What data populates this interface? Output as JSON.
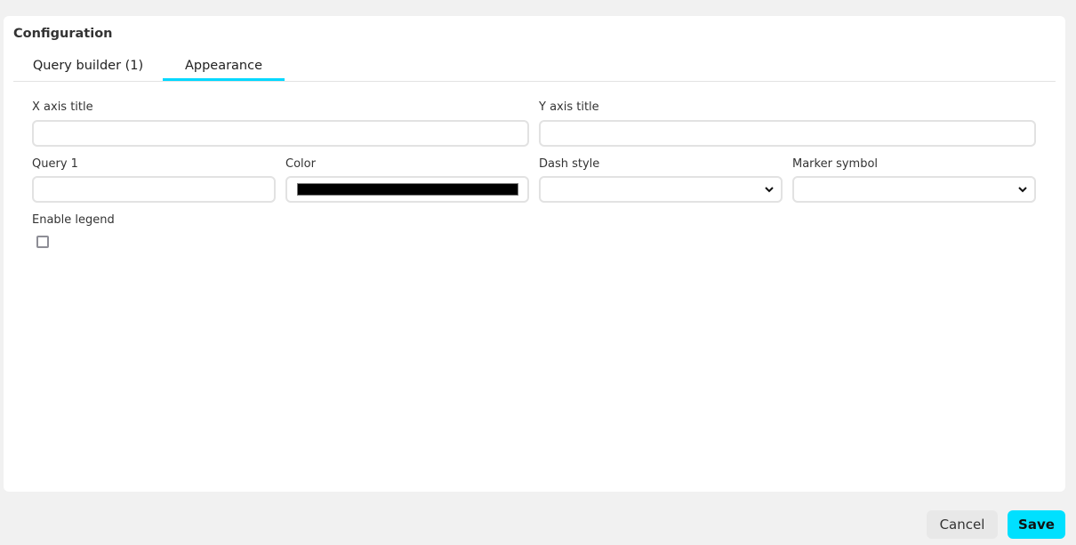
{
  "panel": {
    "title": "Configuration"
  },
  "tabs": [
    {
      "label": "Query builder (1)",
      "active": false
    },
    {
      "label": "Appearance",
      "active": true
    }
  ],
  "form": {
    "x_axis_title": {
      "label": "X axis title",
      "value": ""
    },
    "y_axis_title": {
      "label": "Y axis title",
      "value": ""
    },
    "query1": {
      "label": "Query 1",
      "value": ""
    },
    "color": {
      "label": "Color",
      "value": "#000000"
    },
    "dash_style": {
      "label": "Dash style",
      "value": ""
    },
    "marker_symbol": {
      "label": "Marker symbol",
      "value": ""
    },
    "enable_legend": {
      "label": "Enable legend",
      "checked": false
    }
  },
  "footer": {
    "cancel_label": "Cancel",
    "save_label": "Save"
  },
  "colors": {
    "accent": "#00e0ff",
    "tab_underline": "#00d8ff"
  }
}
